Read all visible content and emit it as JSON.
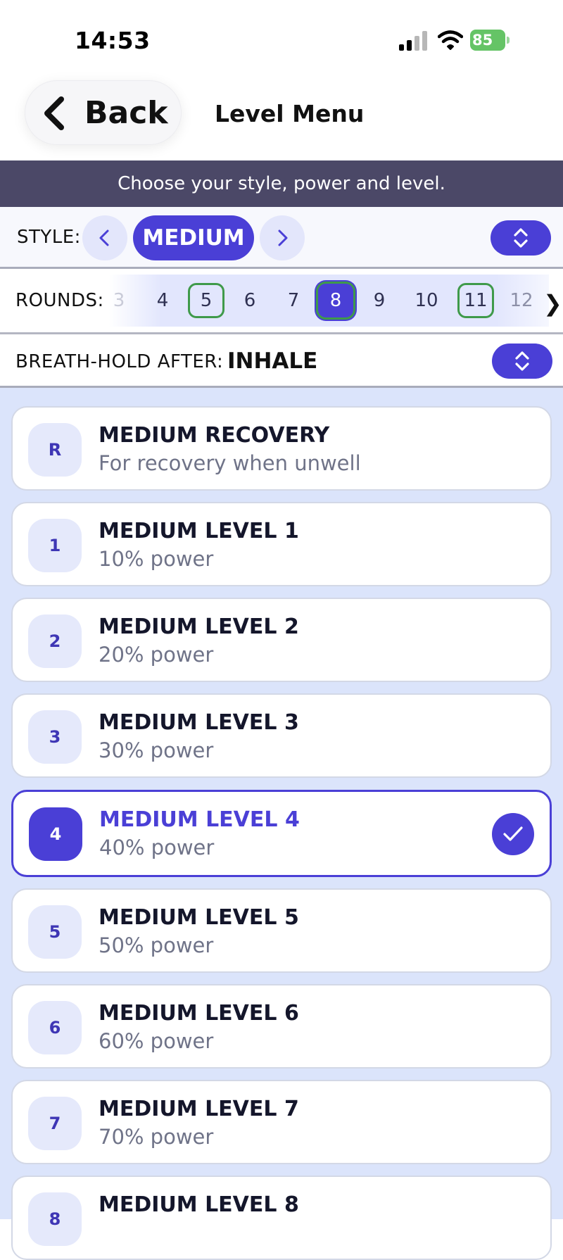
{
  "status_bar": {
    "time": "14:53",
    "battery": "85"
  },
  "header": {
    "back_label": "Back",
    "title": "Level Menu"
  },
  "banner": {
    "text": "Choose your style, power and level."
  },
  "style": {
    "label": "STYLE:",
    "value": "MEDIUM"
  },
  "rounds": {
    "label": "ROUNDS:",
    "items": [
      "3",
      "4",
      "5",
      "6",
      "7",
      "8",
      "9",
      "10",
      "11",
      "12"
    ],
    "selected": "8",
    "milestones": [
      "5",
      "11"
    ],
    "next_glyph": "❯"
  },
  "breath_hold": {
    "label": "BREATH-HOLD AFTER:",
    "value": "INHALE"
  },
  "levels": [
    {
      "badge": "R",
      "title": "MEDIUM RECOVERY",
      "subtitle": "For recovery when unwell"
    },
    {
      "badge": "1",
      "title": "MEDIUM LEVEL 1",
      "subtitle": "10% power"
    },
    {
      "badge": "2",
      "title": "MEDIUM LEVEL 2",
      "subtitle": "20% power"
    },
    {
      "badge": "3",
      "title": "MEDIUM LEVEL 3",
      "subtitle": "30% power"
    },
    {
      "badge": "4",
      "title": "MEDIUM LEVEL 4",
      "subtitle": "40% power",
      "selected": true
    },
    {
      "badge": "5",
      "title": "MEDIUM LEVEL 5",
      "subtitle": "50% power"
    },
    {
      "badge": "6",
      "title": "MEDIUM LEVEL 6",
      "subtitle": "60% power"
    },
    {
      "badge": "7",
      "title": "MEDIUM LEVEL 7",
      "subtitle": "70% power"
    },
    {
      "badge": "8",
      "title": "MEDIUM LEVEL 8",
      "subtitle": ""
    }
  ],
  "colors": {
    "accent": "#4a3fd6",
    "banner": "#4b4867",
    "milestone": "#3f9a4a",
    "list_bg": "#dbe4fb"
  },
  "icons": [
    "signal-icon",
    "wifi-icon",
    "battery-icon",
    "chevron-left-icon",
    "chevron-right-icon",
    "up-down-icon",
    "checkmark-icon"
  ]
}
